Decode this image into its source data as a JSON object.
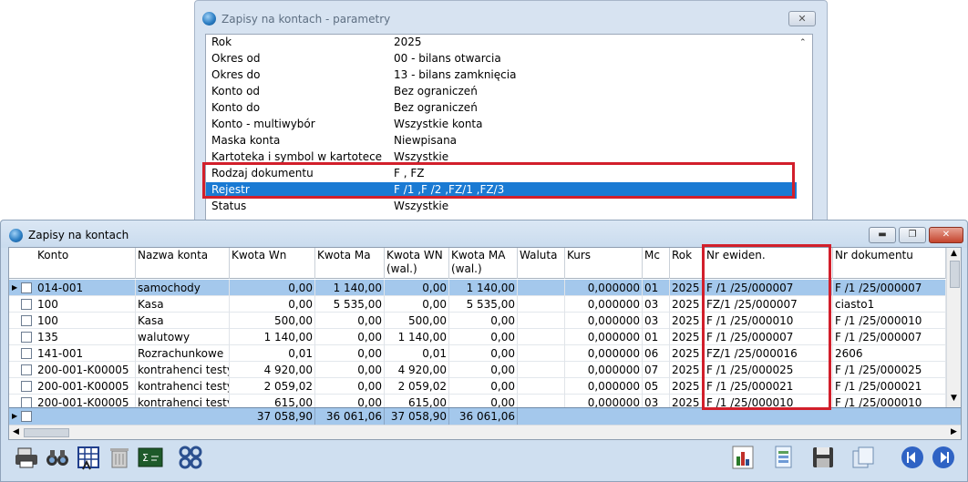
{
  "dialog": {
    "title": "Zapisy na kontach - parametry",
    "close_label": "✕",
    "params": [
      {
        "key": "Rok",
        "value": "2025"
      },
      {
        "key": "Okres od",
        "value": "00 - bilans otwarcia"
      },
      {
        "key": "Okres do",
        "value": "13 - bilans zamknięcia"
      },
      {
        "key": "Konto od",
        "value": "Bez ograniczeń"
      },
      {
        "key": "Konto do",
        "value": "Bez ograniczeń"
      },
      {
        "key": "Konto - multiwybór",
        "value": "Wszystkie konta"
      },
      {
        "key": "Maska konta",
        "value": "Niewpisana"
      },
      {
        "key": "Kartoteka i symbol w kartotece",
        "value": "Wszystkie"
      },
      {
        "key": "Rodzaj dokumentu",
        "value": "F , FZ"
      },
      {
        "key": "Rejestr",
        "value": "F /1 ,F /2 ,FZ/1 ,FZ/3"
      },
      {
        "key": "Status",
        "value": "Wszystkie"
      }
    ]
  },
  "window": {
    "title": "Zapisy na kontach",
    "min_label": "▬",
    "max_label": "❐",
    "close_label": "✕"
  },
  "table": {
    "columns": [
      "Konto",
      "Nazwa konta",
      "Kwota Wn",
      "Kwota Ma",
      "Kwota WN (wal.)",
      "Kwota MA (wal.)",
      "Waluta",
      "Kurs",
      "Mc",
      "Rok",
      "Nr ewiden.",
      "Nr dokumentu"
    ],
    "rows": [
      [
        "014-001",
        "samochody",
        "0,00",
        "1 140,00",
        "0,00",
        "1 140,00",
        "",
        "0,000000",
        "01",
        "2025",
        "F /1  /25/000007",
        "F /1  /25/000007"
      ],
      [
        "100",
        "Kasa",
        "0,00",
        "5 535,00",
        "0,00",
        "5 535,00",
        "",
        "0,000000",
        "03",
        "2025",
        "FZ/1  /25/000007",
        "ciasto1"
      ],
      [
        "100",
        "Kasa",
        "500,00",
        "0,00",
        "500,00",
        "0,00",
        "",
        "0,000000",
        "03",
        "2025",
        "F /1  /25/000010",
        "F /1  /25/000010"
      ],
      [
        "135",
        "walutowy",
        "1 140,00",
        "0,00",
        "1 140,00",
        "0,00",
        "",
        "0,000000",
        "01",
        "2025",
        "F /1  /25/000007",
        "F /1  /25/000007"
      ],
      [
        "141-001",
        "Rozrachunkowe",
        "0,01",
        "0,00",
        "0,01",
        "0,00",
        "",
        "0,000000",
        "06",
        "2025",
        "FZ/1  /25/000016",
        "2606"
      ],
      [
        "200-001-K00005",
        "kontrahenci testy/k",
        "4 920,00",
        "0,00",
        "4 920,00",
        "0,00",
        "",
        "0,000000",
        "07",
        "2025",
        "F /1  /25/000025",
        "F /1  /25/000025"
      ],
      [
        "200-001-K00005",
        "kontrahenci testy/k",
        "2 059,02",
        "0,00",
        "2 059,02",
        "0,00",
        "",
        "0,000000",
        "05",
        "2025",
        "F /1  /25/000021",
        "F /1  /25/000021"
      ],
      [
        "200-001-K00005",
        "kontrahenci testy/k",
        "615,00",
        "0,00",
        "615,00",
        "0,00",
        "",
        "0,000000",
        "03",
        "2025",
        "F /1  /25/000010",
        "F /1  /25/000010"
      ]
    ],
    "totals": {
      "wn": "37 058,90",
      "ma": "36 061,06",
      "wn_wal": "37 058,90",
      "ma_wal": "36 061,06"
    }
  },
  "toolbar": [
    "print-icon",
    "binoculars-icon",
    "calculator-icon",
    "trash-icon",
    "export-icon",
    "filter-icon",
    "chart-icon",
    "report-icon",
    "save-icon",
    "copy-icon",
    "prev-icon",
    "next-icon"
  ]
}
